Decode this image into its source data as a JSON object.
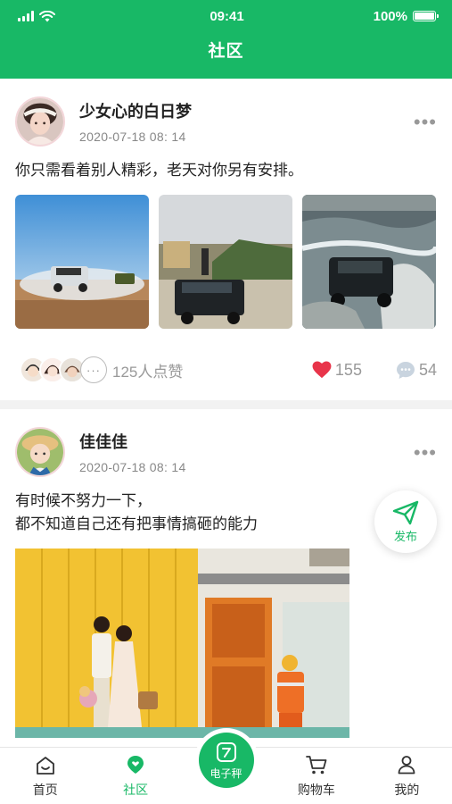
{
  "status_bar": {
    "time": "09:41",
    "battery": "100%",
    "battery_level": 1.0
  },
  "nav": {
    "title": "社区"
  },
  "posts": [
    {
      "author": "少女心的白日梦",
      "time": "2020-07-18  08: 14",
      "text_lines": [
        "你只需看着别人精彩，老天对你另有安排。"
      ],
      "likes_text": "125人点赞",
      "like_count": "155",
      "comment_count": "54"
    },
    {
      "author": "佳佳佳",
      "time": "2020-07-18  08: 14",
      "text_lines": [
        "有时候不努力一下，",
        "都不知道自己还有把事情搞砸的能力"
      ]
    }
  ],
  "publish": {
    "label": "发布"
  },
  "tabbar": {
    "items": [
      {
        "label": "首页",
        "icon": "home-icon"
      },
      {
        "label": "社区",
        "icon": "community-icon",
        "active": true
      },
      {
        "label": "电子秤",
        "icon": "scale-icon"
      },
      {
        "label": "购物车",
        "icon": "cart-icon"
      },
      {
        "label": "我的",
        "icon": "profile-icon"
      }
    ]
  },
  "colors": {
    "brand": "#18b866",
    "like": "#e8344a",
    "text": "#222222",
    "muted": "#999999"
  }
}
